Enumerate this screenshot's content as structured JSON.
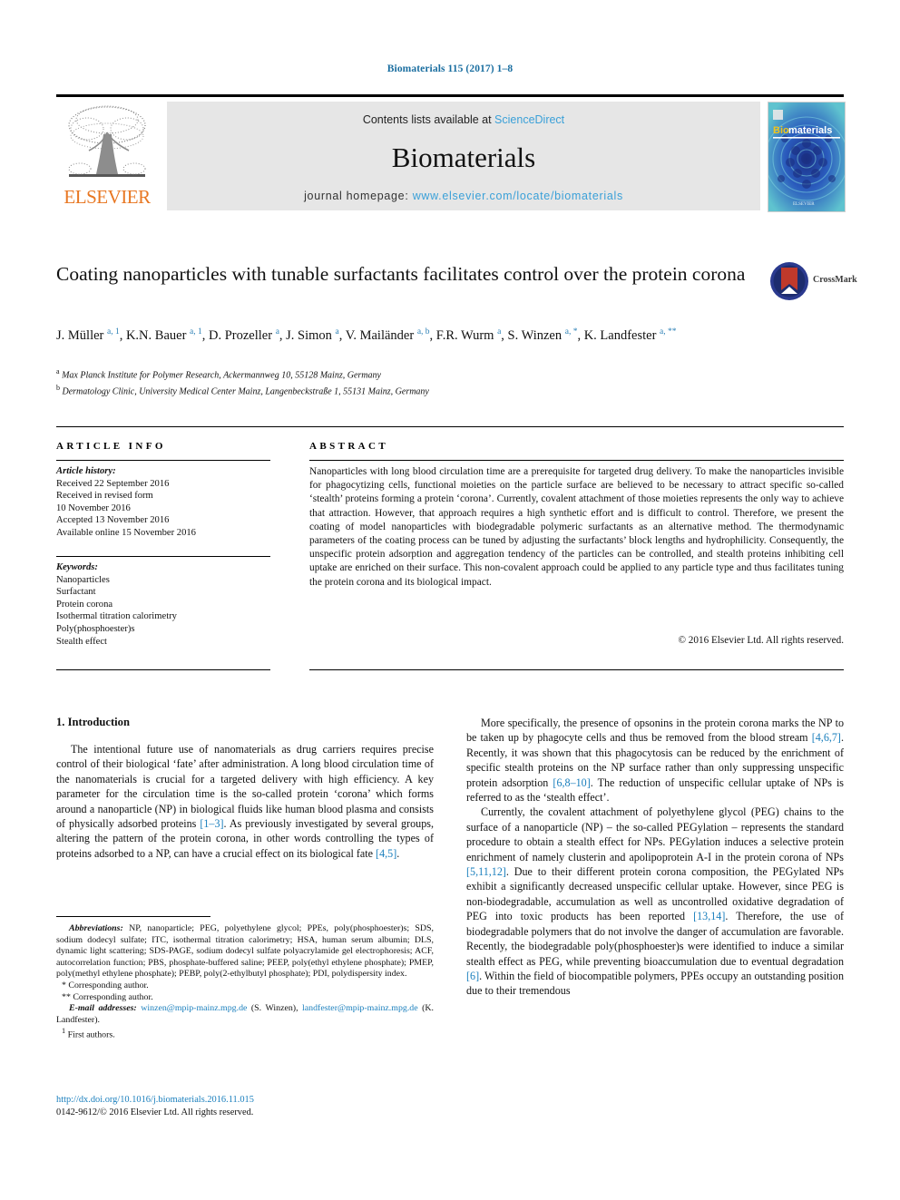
{
  "running_head": "Biomaterials 115 (2017) 1–8",
  "masthead": {
    "contents_prefix": "Contents lists available at ",
    "sciencedirect": "ScienceDirect",
    "journal_name": "Biomaterials",
    "homepage_prefix": "journal homepage: ",
    "homepage_url": "www.elsevier.com/locate/biomaterials",
    "publisher_logo_text": "ELSEVIER",
    "cover_title_bio": "Bio",
    "cover_title_materials": "materials",
    "cover_footer": "ELSEVIER"
  },
  "article": {
    "title": "Coating nanoparticles with tunable surfactants facilitates control over the protein corona",
    "crossmark_label": "CrossMark",
    "authors_html": "J. Müller <sup>a, 1</sup>, K.N. Bauer <sup>a, 1</sup>, D. Prozeller <sup>a</sup>, J. Simon <sup>a</sup>, V. Mailänder <sup>a, b</sup>, F.R. Wurm <sup>a</sup>, S. Winzen <sup>a, *</sup>, K. Landfester <sup>a, **</sup>",
    "affiliation_a": "Max Planck Institute for Polymer Research, Ackermannweg 10, 55128 Mainz, Germany",
    "affiliation_b": "Dermatology Clinic, University Medical Center Mainz, Langenbeckstraße 1, 55131 Mainz, Germany"
  },
  "info": {
    "heading": "ARTICLE INFO",
    "history_label": "Article history:",
    "history_lines": [
      "Received 22 September 2016",
      "Received in revised form",
      "10 November 2016",
      "Accepted 13 November 2016",
      "Available online 15 November 2016"
    ],
    "keywords_label": "Keywords:",
    "keywords": [
      "Nanoparticles",
      "Surfactant",
      "Protein corona",
      "Isothermal titration calorimetry",
      "Poly(phosphoester)s",
      "Stealth effect"
    ]
  },
  "abstract": {
    "heading": "ABSTRACT",
    "text": "Nanoparticles with long blood circulation time are a prerequisite for targeted drug delivery. To make the nanoparticles invisible for phagocytizing cells, functional moieties on the particle surface are believed to be necessary to attract specific so-called ‘stealth’ proteins forming a protein ‘corona’. Currently, covalent attachment of those moieties represents the only way to achieve that attraction. However, that approach requires a high synthetic effort and is difficult to control. Therefore, we present the coating of model nanoparticles with biodegradable polymeric surfactants as an alternative method. The thermodynamic parameters of the coating process can be tuned by adjusting the surfactants’ block lengths and hydrophilicity. Consequently, the unspecific protein adsorption and aggregation tendency of the particles can be controlled, and stealth proteins inhibiting cell uptake are enriched on their surface. This non-covalent approach could be applied to any particle type and thus facilitates tuning the protein corona and its biological impact.",
    "copyright": "© 2016 Elsevier Ltd. All rights reserved."
  },
  "body": {
    "section_number_title": "1. Introduction",
    "left_paragraph_1_parts": [
      "The intentional future use of nanomaterials as drug carriers requires precise control of their biological ‘fate’ after administration. A long blood circulation time of the nanomaterials is crucial for a targeted delivery with high efficiency. A key parameter for the circulation time is the so-called protein ‘corona’ which forms around a nanoparticle (NP) in biological fluids like human blood plasma and consists of physically adsorbed proteins ",
      "[1–3]",
      ". As previously investigated by several groups, altering the pattern of the protein corona, in other words controlling the types of proteins adsorbed to a NP, can have a crucial effect on its biological fate ",
      "[4,5]",
      "."
    ],
    "right_paragraph_1_parts": [
      "More specifically, the presence of opsonins in the protein corona marks the NP to be taken up by phagocyte cells and thus be removed from the blood stream ",
      "[4,6,7]",
      ". Recently, it was shown that this phagocytosis can be reduced by the enrichment of specific stealth proteins on the NP surface rather than only suppressing unspecific protein adsorption ",
      "[6,8–10]",
      ". The reduction of unspecific cellular uptake of NPs is referred to as the ‘stealth effect’."
    ],
    "right_paragraph_2_parts": [
      "Currently, the covalent attachment of polyethylene glycol (PEG) chains to the surface of a nanoparticle (NP) – the so-called PEGylation – represents the standard procedure to obtain a stealth effect for NPs. PEGylation induces a selective protein enrichment of namely clusterin and apolipoprotein A-I in the protein corona of NPs ",
      "[5,11,12]",
      ". Due to their different protein corona composition, the PEGylated NPs exhibit a significantly decreased unspecific cellular uptake. However, since PEG is non-biodegradable, accumulation as well as uncontrolled oxidative degradation of PEG into toxic products has been reported ",
      "[13,14]",
      ". Therefore, the use of biodegradable polymers that do not involve the danger of accumulation are favorable. Recently, the biodegradable poly(phosphoester)s were identified to induce a similar stealth effect as PEG, while preventing bioaccumulation due to eventual degradation ",
      "[6]",
      ". Within the field of biocompatible polymers, PPEs occupy an outstanding position due to their tremendous"
    ]
  },
  "footnotes": {
    "abbreviations_label": "Abbreviations:",
    "abbreviations_text": " NP, nanoparticle; PEG, polyethylene glycol; PPEs, poly(phosphoester)s; SDS, sodium dodecyl sulfate; ITC, isothermal titration calorimetry; HSA, human serum albumin; DLS, dynamic light scattering; SDS-PAGE, sodium dodecyl sulfate polyacrylamide gel electrophoresis; ACF, autocorrelation function; PBS, phosphate-buffered saline; PEEP, poly(ethyl ethylene phosphate); PMEP, poly(methyl ethylene phosphate); PEBP, poly(2-ethylbutyl phosphate); PDI, polydispersity index.",
    "corresponding_1_marker": "*",
    "corresponding_1": "Corresponding author.",
    "corresponding_2_marker": "**",
    "corresponding_2": "Corresponding author.",
    "email_label": "E-mail addresses:",
    "email_1": "winzen@mpip-mainz.mpg.de",
    "email_1_name": " (S. Winzen), ",
    "email_2": "landfester@mpip-mainz.mpg.de",
    "email_2_name": " (K. Landfester).",
    "first_authors_marker": "1",
    "first_authors": "First authors."
  },
  "doi_block": {
    "doi_url": "http://dx.doi.org/10.1016/j.biomaterials.2016.11.015",
    "issn_copyright": "0142-9612/© 2016 Elsevier Ltd. All rights reserved."
  },
  "colors": {
    "link_blue": "#1a7fbd",
    "header_blue": "#1a6ea0",
    "sciencedirect_blue": "#3aa0d8",
    "elsevier_orange": "#e87722",
    "masthead_gray": "#e6e6e6"
  }
}
